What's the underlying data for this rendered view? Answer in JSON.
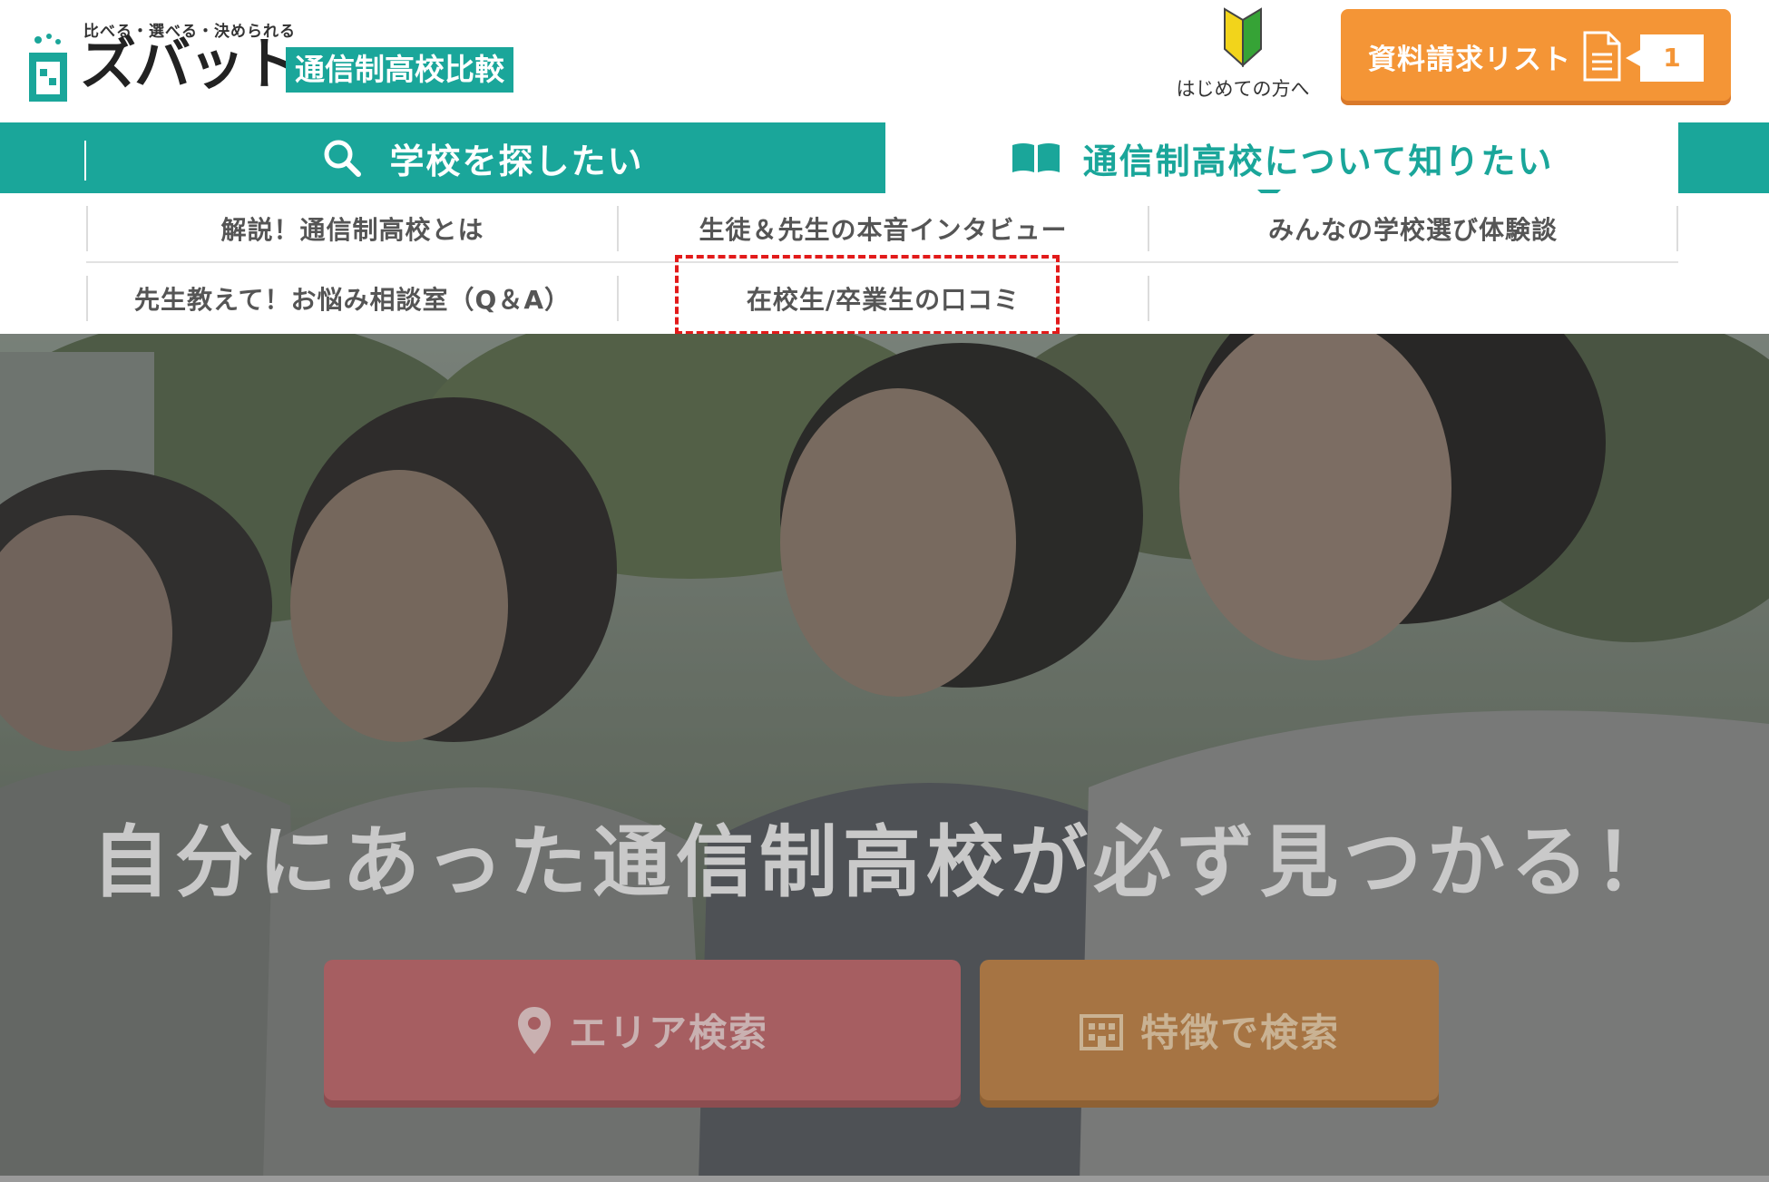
{
  "header": {
    "logo": {
      "tagline": "比べる・選べる・決められる",
      "name": "ズバット",
      "subtitle": "通信制高校比較"
    },
    "beginner_label": "はじめての方へ",
    "request_list": {
      "label": "資料請求リスト",
      "count": "1"
    }
  },
  "main_nav": {
    "search_tab": "学校を探したい",
    "know_tab": "通信制高校について知りたい"
  },
  "sub_nav": {
    "items": [
      "解説！通信制高校とは",
      "生徒＆先生の本音インタビュー",
      "みんなの学校選び体験談",
      "先生教えて！お悩み相談室（Q＆A）",
      "在校生/卒業生の口コミ"
    ]
  },
  "hero": {
    "title": "自分にあった通信制高校が必ず見つかる！",
    "area_search": "エリア検索",
    "feature_search": "特徴で検索"
  },
  "icons": {
    "beginner": "beginner-mark-icon",
    "request_doc": "document-icon",
    "search": "search-icon",
    "book": "book-icon",
    "pin": "map-pin-icon",
    "building": "building-icon"
  },
  "colors": {
    "brand_teal": "#1aa69a",
    "request_orange": "#f49536",
    "highlight_red": "#e21a1a",
    "area_button": "#a65e61",
    "feature_button": "#a67443"
  }
}
